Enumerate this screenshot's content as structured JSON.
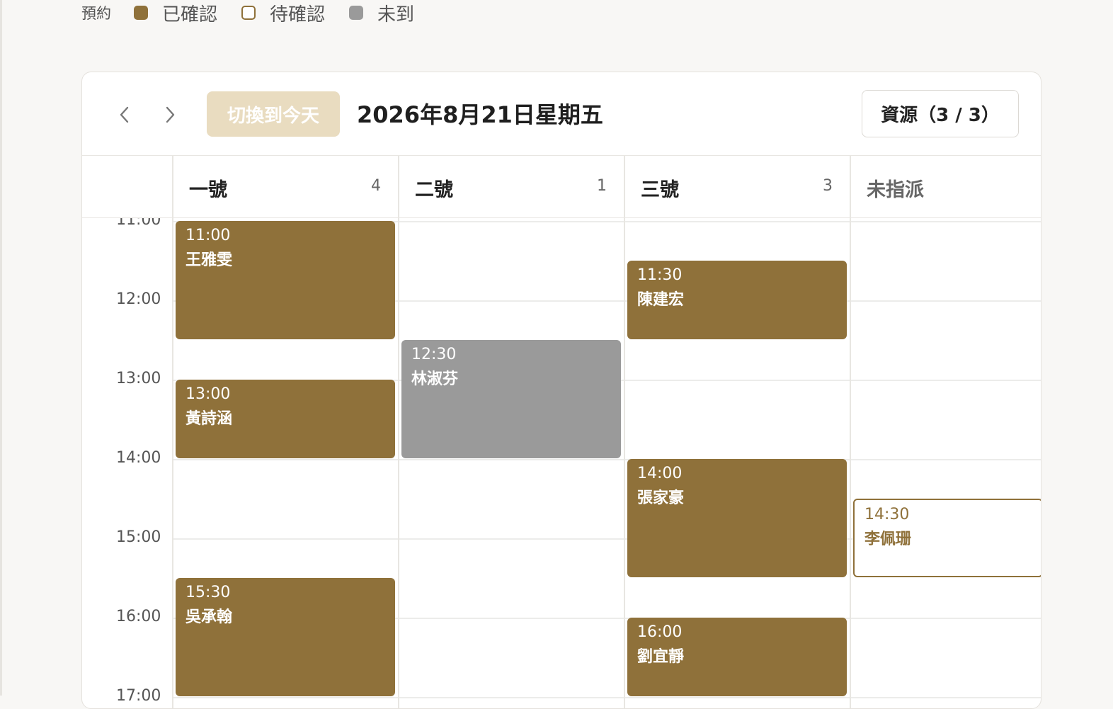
{
  "legend": {
    "title": "預約",
    "items": [
      {
        "label": "已確認",
        "style": "filled",
        "color": "#8f713a"
      },
      {
        "label": "待確認",
        "style": "outline",
        "color": "#8f713a"
      },
      {
        "label": "未到",
        "style": "filled",
        "color": "#9a9a9a"
      }
    ]
  },
  "toolbar": {
    "prev_icon": "chevron-left-icon",
    "next_icon": "chevron-right-icon",
    "today_label": "切換到今天",
    "date_title": "2026年8月21日星期五",
    "resources_label": "資源（3 / 3）"
  },
  "columns": [
    {
      "name": "一號",
      "count": "4"
    },
    {
      "name": "二號",
      "count": "1"
    },
    {
      "name": "三號",
      "count": "3"
    },
    {
      "name": "未指派",
      "count": ""
    }
  ],
  "time_labels": [
    "11:00",
    "12:00",
    "13:00",
    "14:00",
    "15:00",
    "16:00",
    "17:00"
  ],
  "events": [
    {
      "col": 0,
      "start": "11:00",
      "end": "12:30",
      "time": "11:00",
      "name": "王雅雯",
      "status": "confirmed"
    },
    {
      "col": 0,
      "start": "13:00",
      "end": "14:00",
      "time": "13:00",
      "name": "黃詩涵",
      "status": "confirmed"
    },
    {
      "col": 0,
      "start": "15:30",
      "end": "17:00",
      "time": "15:30",
      "name": "吳承翰",
      "status": "confirmed"
    },
    {
      "col": 1,
      "start": "12:30",
      "end": "14:00",
      "time": "12:30",
      "name": "林淑芬",
      "status": "noshow"
    },
    {
      "col": 2,
      "start": "11:30",
      "end": "12:30",
      "time": "11:30",
      "name": "陳建宏",
      "status": "confirmed"
    },
    {
      "col": 2,
      "start": "14:00",
      "end": "15:30",
      "time": "14:00",
      "name": "張家豪",
      "status": "confirmed"
    },
    {
      "col": 2,
      "start": "16:00",
      "end": "17:00",
      "time": "16:00",
      "name": "劉宜靜",
      "status": "confirmed"
    },
    {
      "col": 3,
      "start": "14:30",
      "end": "15:30",
      "time": "14:30",
      "name": "李佩珊",
      "status": "pending"
    }
  ],
  "colors": {
    "confirmed": "#8f713a",
    "noshow": "#9a9a9a",
    "pending_border": "#8f713a",
    "pending_text": "#8f713a",
    "today_bg": "#e9dcc0",
    "today_text": "#ffffff",
    "chevron": "#777777"
  }
}
